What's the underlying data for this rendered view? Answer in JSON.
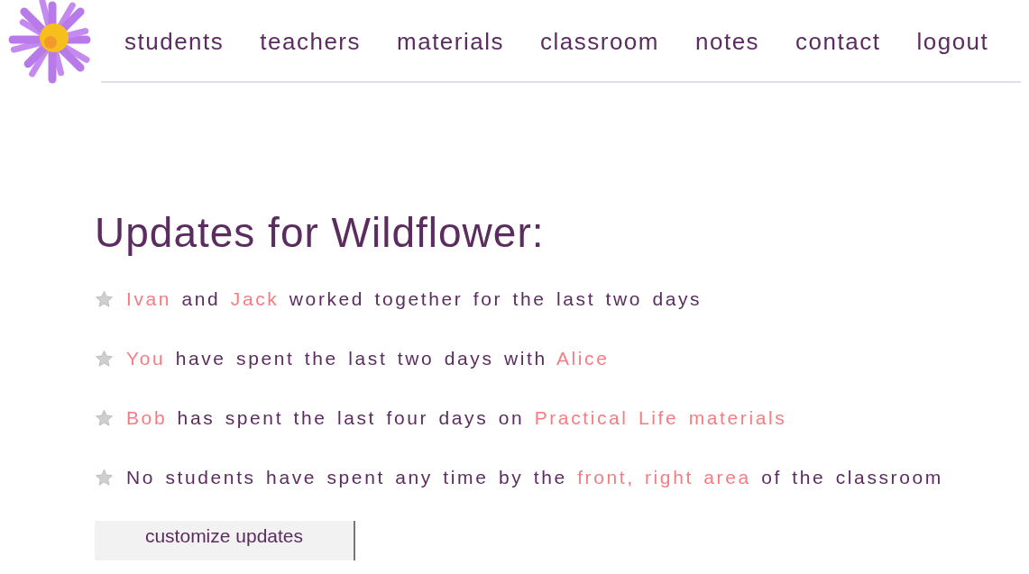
{
  "nav": {
    "items": [
      {
        "label": "students"
      },
      {
        "label": "teachers"
      },
      {
        "label": "materials"
      },
      {
        "label": "classroom"
      },
      {
        "label": "notes"
      },
      {
        "label": "contact"
      },
      {
        "label": "logout"
      }
    ]
  },
  "heading": "Updates for Wildflower:",
  "updates": [
    {
      "parts": [
        {
          "text": "Ivan",
          "highlight": true
        },
        {
          "text": " and ",
          "highlight": false
        },
        {
          "text": "Jack",
          "highlight": true
        },
        {
          "text": " worked together for the last two days",
          "highlight": false
        }
      ]
    },
    {
      "parts": [
        {
          "text": "You",
          "highlight": true
        },
        {
          "text": " have spent the last two days with ",
          "highlight": false
        },
        {
          "text": "Alice",
          "highlight": true
        }
      ]
    },
    {
      "parts": [
        {
          "text": "Bob",
          "highlight": true
        },
        {
          "text": " has spent the last four days on ",
          "highlight": false
        },
        {
          "text": "Practical Life materials",
          "highlight": true
        }
      ]
    },
    {
      "parts": [
        {
          "text": "No students have spent any time by the ",
          "highlight": false
        },
        {
          "text": "front, right area",
          "highlight": true
        },
        {
          "text": " of the classroom",
          "highlight": false
        }
      ]
    }
  ],
  "button": {
    "label": "customize updates"
  }
}
